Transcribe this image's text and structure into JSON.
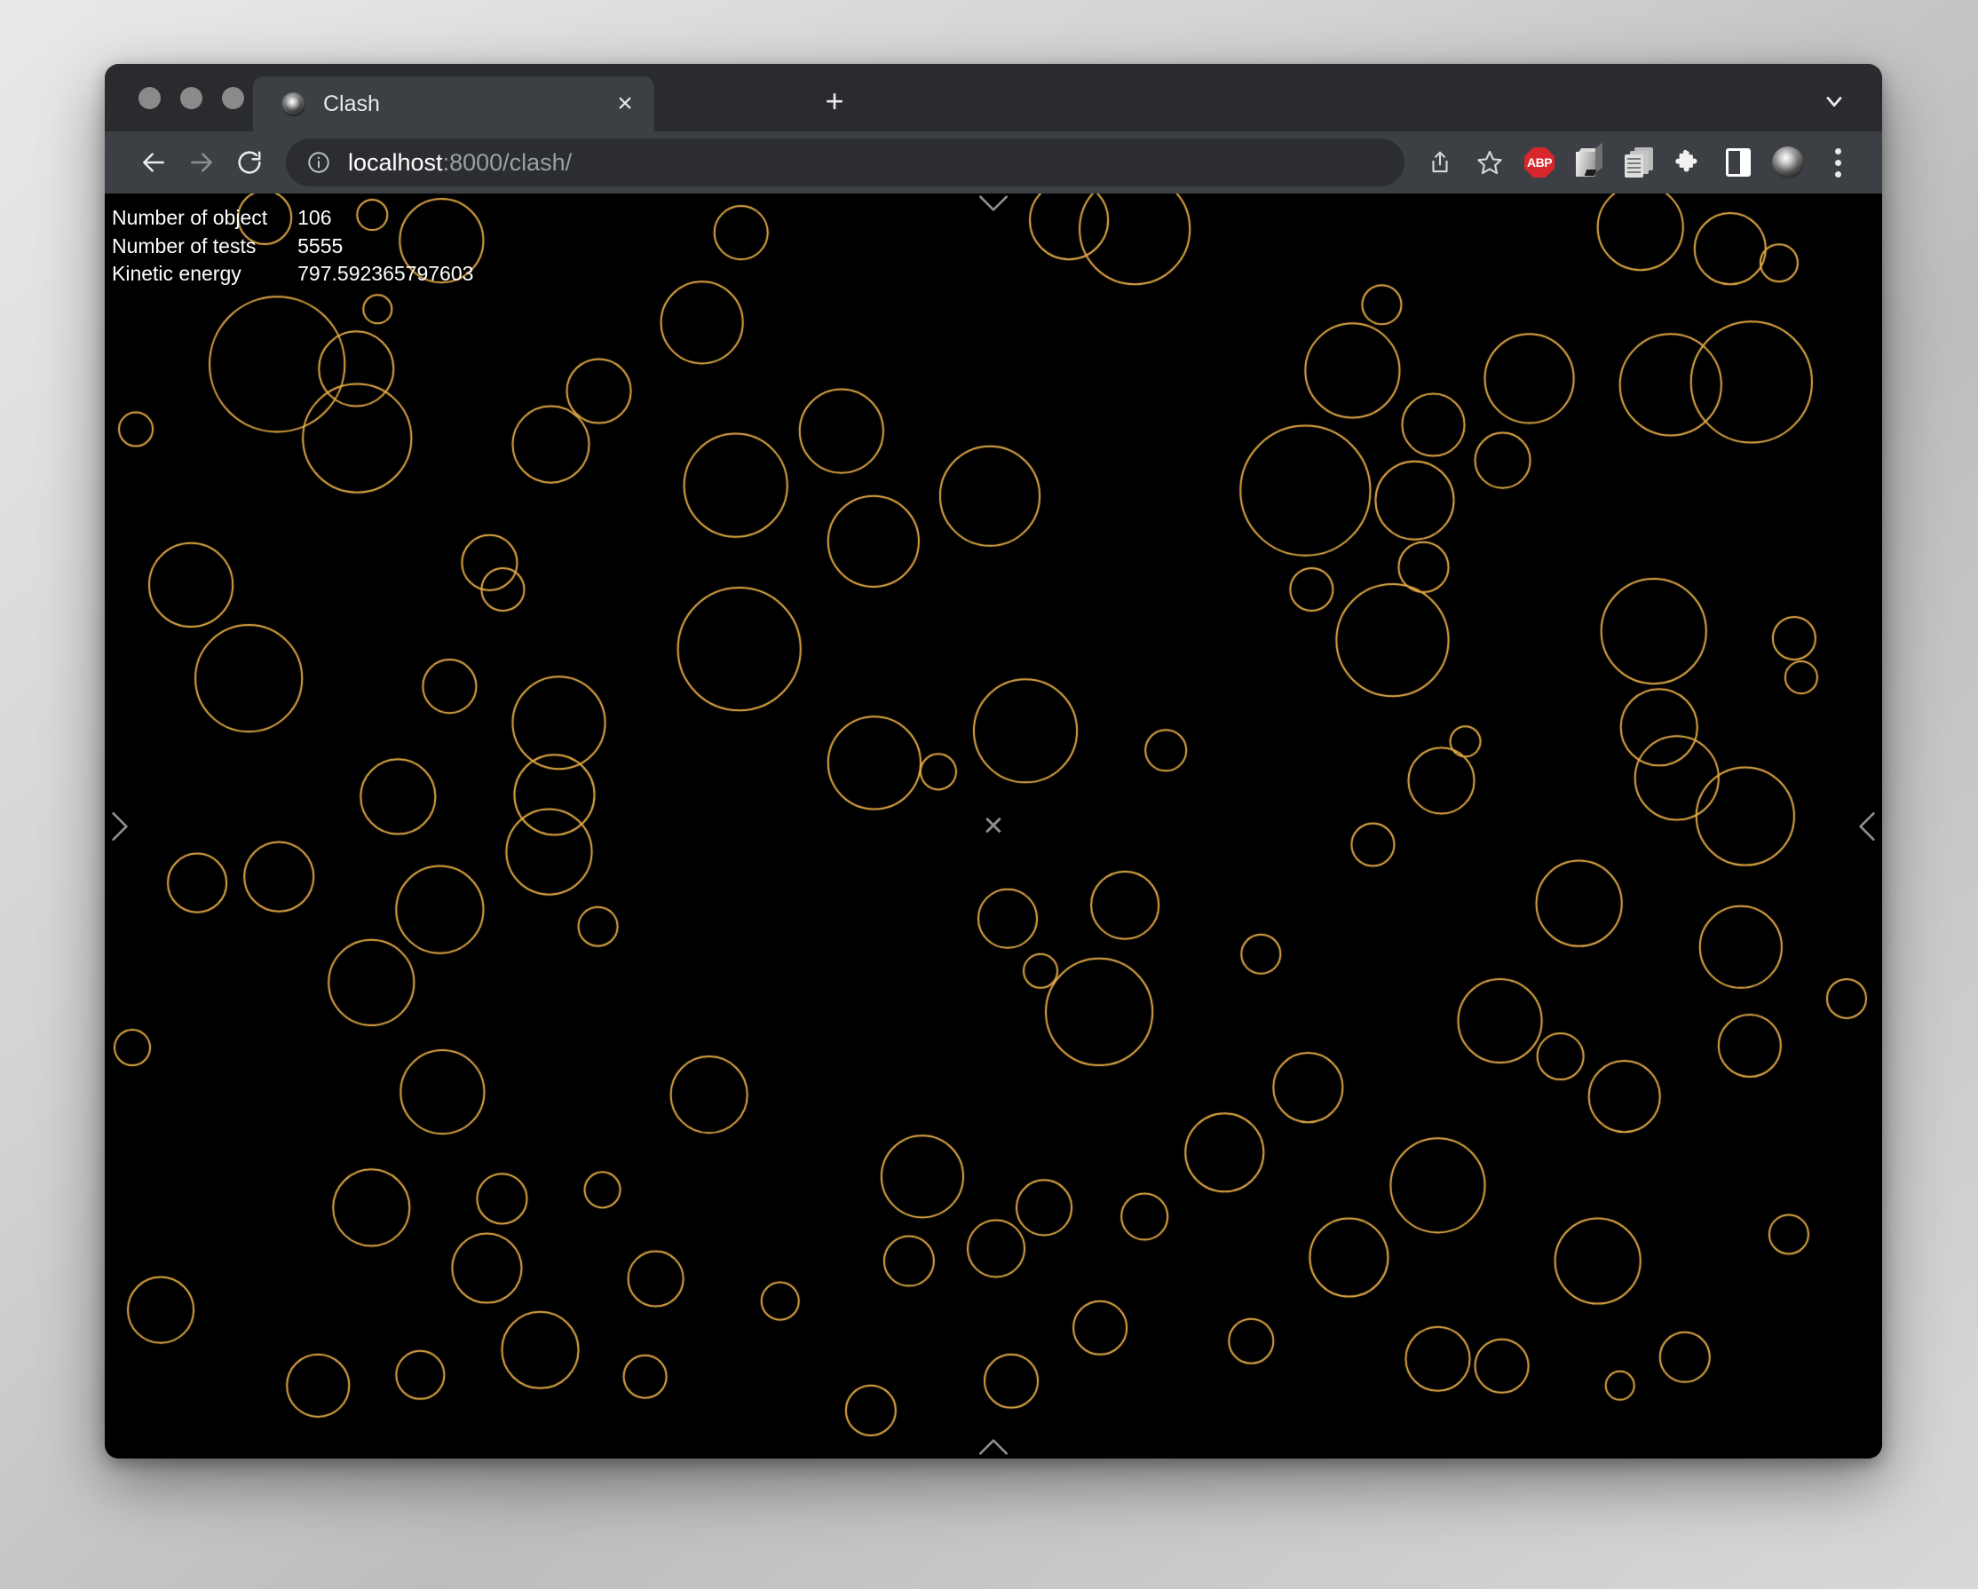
{
  "window": {
    "traffic_lights": [
      "close",
      "minimize",
      "maximize"
    ]
  },
  "tab_strip": {
    "tabs": [
      {
        "title": "Clash",
        "favicon": "sphere-icon",
        "close_label": "×"
      }
    ],
    "new_tab_label": "+",
    "tab_list_icon": "chevron-down-icon"
  },
  "toolbar": {
    "back_icon": "back-arrow-icon",
    "forward_icon": "forward-arrow-icon",
    "reload_icon": "reload-icon",
    "site_info_icon": "info-circle-icon",
    "url": {
      "host": "localhost",
      "rest": ":8000/clash/",
      "full": "localhost:8000/clash/"
    },
    "actions": [
      {
        "name": "share-icon",
        "label": "Share"
      },
      {
        "name": "bookmark-star-icon",
        "label": "Bookmark"
      },
      {
        "name": "adblock-plus-icon",
        "label": "ABP"
      },
      {
        "name": "cube-extension-icon",
        "label": "Cube"
      },
      {
        "name": "copy-documents-icon",
        "label": "Copy"
      },
      {
        "name": "extensions-puzzle-icon",
        "label": "Extensions"
      },
      {
        "name": "side-panel-icon",
        "label": "Side panel"
      },
      {
        "name": "knob-extension-icon",
        "label": "Knob"
      },
      {
        "name": "more-menu-icon",
        "label": "More"
      }
    ]
  },
  "page": {
    "background": "#000000",
    "circle_stroke": "#e4ab46",
    "stats": [
      {
        "label": "Number of object",
        "value": "106"
      },
      {
        "label": "Number of tests",
        "value": "5555"
      },
      {
        "label": "Kinetic energy",
        "value": "797.592365797603"
      }
    ],
    "markers": {
      "left": "chevron-right-icon",
      "right": "chevron-left-icon",
      "top": "chevron-down-icon",
      "bottom": "chevron-up-icon",
      "center": "✕"
    }
  },
  "chart_data": {
    "type": "scatter",
    "title": "Clash particle collision simulation",
    "xlabel": "",
    "ylabel": "",
    "xlim": [
      0,
      2000
    ],
    "ylim": [
      0,
      1422
    ],
    "grid": false,
    "legend": null,
    "stroke_color": "#e4ab46",
    "fill_color": "#000000",
    "stroke_width": 2,
    "object_count": 106,
    "test_count": 5555,
    "kinetic_energy": 797.592365797603,
    "columns": [
      "cx",
      "cy",
      "r"
    ],
    "circles": [
      [
        180,
        27,
        30
      ],
      [
        301,
        24,
        17
      ],
      [
        379,
        53,
        47
      ],
      [
        716,
        44,
        30
      ],
      [
        1085,
        30,
        44
      ],
      [
        1159,
        40,
        62
      ],
      [
        1728,
        38,
        48
      ],
      [
        1829,
        62,
        40
      ],
      [
        1884,
        78,
        21
      ],
      [
        307,
        130,
        16
      ],
      [
        1437,
        125,
        22
      ],
      [
        672,
        145,
        46
      ],
      [
        194,
        192,
        76
      ],
      [
        283,
        197,
        42
      ],
      [
        556,
        222,
        36
      ],
      [
        1404,
        199,
        53
      ],
      [
        1603,
        208,
        50
      ],
      [
        1762,
        215,
        57
      ],
      [
        1853,
        212,
        68
      ],
      [
        35,
        265,
        19
      ],
      [
        284,
        275,
        61
      ],
      [
        502,
        282,
        43
      ],
      [
        829,
        267,
        47
      ],
      [
        1495,
        260,
        35
      ],
      [
        1573,
        300,
        31
      ],
      [
        710,
        328,
        58
      ],
      [
        996,
        340,
        56
      ],
      [
        1351,
        334,
        73
      ],
      [
        1474,
        345,
        44
      ],
      [
        865,
        391,
        51
      ],
      [
        1484,
        420,
        28
      ],
      [
        1358,
        445,
        24
      ],
      [
        97,
        440,
        47
      ],
      [
        433,
        415,
        31
      ],
      [
        448,
        445,
        24
      ],
      [
        1449,
        502,
        63
      ],
      [
        1743,
        492,
        59
      ],
      [
        1901,
        500,
        24
      ],
      [
        1909,
        544,
        18
      ],
      [
        714,
        512,
        69
      ],
      [
        162,
        545,
        60
      ],
      [
        1749,
        600,
        43
      ],
      [
        388,
        554,
        30
      ],
      [
        1531,
        616,
        17
      ],
      [
        511,
        595,
        52
      ],
      [
        1036,
        604,
        58
      ],
      [
        1194,
        626,
        23
      ],
      [
        1769,
        657,
        47
      ],
      [
        506,
        676,
        45
      ],
      [
        866,
        640,
        52
      ],
      [
        938,
        650,
        20
      ],
      [
        1504,
        660,
        37
      ],
      [
        330,
        678,
        42
      ],
      [
        500,
        740,
        48
      ],
      [
        1846,
        700,
        55
      ],
      [
        1427,
        732,
        24
      ],
      [
        104,
        775,
        33
      ],
      [
        196,
        768,
        39
      ],
      [
        377,
        805,
        49
      ],
      [
        1016,
        815,
        33
      ],
      [
        555,
        824,
        22
      ],
      [
        1148,
        800,
        38
      ],
      [
        1841,
        847,
        46
      ],
      [
        1659,
        798,
        48
      ],
      [
        1301,
        855,
        22
      ],
      [
        300,
        887,
        48
      ],
      [
        1053,
        874,
        19
      ],
      [
        1119,
        920,
        60
      ],
      [
        1570,
        930,
        47
      ],
      [
        1851,
        958,
        35
      ],
      [
        1960,
        905,
        22
      ],
      [
        680,
        1013,
        43
      ],
      [
        31,
        960,
        20
      ],
      [
        1354,
        1005,
        39
      ],
      [
        1638,
        970,
        26
      ],
      [
        1710,
        1015,
        40
      ],
      [
        380,
        1010,
        47
      ],
      [
        1260,
        1078,
        44
      ],
      [
        1500,
        1115,
        53
      ],
      [
        920,
        1105,
        46
      ],
      [
        1057,
        1140,
        31
      ],
      [
        1170,
        1150,
        26
      ],
      [
        300,
        1140,
        43
      ],
      [
        447,
        1130,
        28
      ],
      [
        560,
        1120,
        20
      ],
      [
        1895,
        1170,
        22
      ],
      [
        1400,
        1196,
        44
      ],
      [
        1680,
        1200,
        48
      ],
      [
        430,
        1208,
        39
      ],
      [
        620,
        1220,
        31
      ],
      [
        905,
        1200,
        28
      ],
      [
        760,
        1245,
        21
      ],
      [
        1003,
        1186,
        32
      ],
      [
        63,
        1255,
        37
      ],
      [
        1120,
        1275,
        30
      ],
      [
        1290,
        1290,
        25
      ],
      [
        490,
        1300,
        43
      ],
      [
        1500,
        1310,
        36
      ],
      [
        1572,
        1318,
        30
      ],
      [
        1778,
        1308,
        28
      ],
      [
        1020,
        1335,
        30
      ],
      [
        240,
        1340,
        35
      ],
      [
        355,
        1328,
        27
      ],
      [
        608,
        1330,
        24
      ],
      [
        1705,
        1340,
        16
      ],
      [
        862,
        1368,
        28
      ]
    ]
  }
}
